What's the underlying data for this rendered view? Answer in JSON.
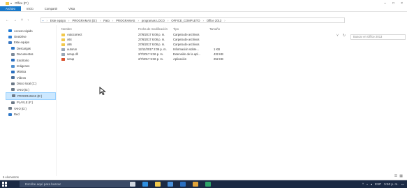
{
  "window": {
    "title": "Office (P:)",
    "ribbon_tabs": [
      "Archivo",
      "Inicio",
      "Compartir",
      "Vista"
    ],
    "caption_buttons": [
      "–",
      "□",
      "×"
    ]
  },
  "address": {
    "crumbs": [
      "Este equipo",
      "PROGRAMAS (D:)",
      "Pato",
      "PROGRAMAS",
      "programas LOCO",
      "OFFICE_COMPLETO",
      "Office 2013"
    ],
    "search_placeholder": "Buscar en Office 2013"
  },
  "nav_pane": {
    "items": [
      {
        "label": "Acceso rápido",
        "icon": "star-icon",
        "color": "#1e7bd6",
        "sub": false
      },
      {
        "label": "OneDrive",
        "icon": "cloud-icon",
        "color": "#2c7fd8",
        "sub": false
      },
      {
        "label": "Este equipo",
        "icon": "computer-icon",
        "color": "#3a78c2",
        "sub": false
      },
      {
        "label": "Descargas",
        "icon": "download-icon",
        "color": "#2f78c8",
        "sub": true
      },
      {
        "label": "Documentos",
        "icon": "document-icon",
        "color": "#7c8a9a",
        "sub": true
      },
      {
        "label": "Escritorio",
        "icon": "desktop-icon",
        "color": "#2a6fc0",
        "sub": true
      },
      {
        "label": "Imágenes",
        "icon": "pictures-icon",
        "color": "#4f8fd0",
        "sub": true
      },
      {
        "label": "Música",
        "icon": "music-icon",
        "color": "#2a6fc0",
        "sub": true
      },
      {
        "label": "Vídeos",
        "icon": "video-icon",
        "color": "#4a6e9a",
        "sub": true
      },
      {
        "label": "Disco local (C:)",
        "icon": "drive-icon",
        "color": "#6d7a88",
        "sub": true
      },
      {
        "label": "VAIO (D:)",
        "icon": "drive-icon",
        "color": "#6d7a88",
        "sub": true
      },
      {
        "label": "PROGRAMAS (E:)",
        "icon": "drive-icon",
        "color": "#6d7a88",
        "sub": true,
        "selected": true
      },
      {
        "label": "PLAYLE (F:)",
        "icon": "drive-icon",
        "color": "#6d7a88",
        "sub": true
      },
      {
        "label": "VAIO (D:)",
        "icon": "drive-icon",
        "color": "#6d7a88",
        "sub": false
      },
      {
        "label": "Red",
        "icon": "network-icon",
        "color": "#2f78c8",
        "sub": false
      }
    ]
  },
  "file_list": {
    "columns": [
      "Nombre",
      "Fecha de modificación",
      "Tipo",
      "Tamaño"
    ],
    "rows": [
      {
        "name": "Autocorrect",
        "date": "27/6/2017 6:08 p. m.",
        "type": "Carpeta de archivos",
        "size": "",
        "kind": "folder"
      },
      {
        "name": "x64",
        "date": "27/6/2017 6:08 p. m.",
        "type": "Carpeta de archivos",
        "size": "",
        "kind": "folder"
      },
      {
        "name": "x86",
        "date": "27/6/2017 6:08 p. m.",
        "type": "Carpeta de archivos",
        "size": "",
        "kind": "folder"
      },
      {
        "name": "autorun",
        "date": "12/12/2017 2:06 p. m.",
        "type": "Información sobre...",
        "size": "1 KB",
        "kind": "file"
      },
      {
        "name": "setup.dll",
        "date": "2/7/2017 5:36 p. m.",
        "type": "Extensión de la apl...",
        "size": "432 KB",
        "kind": "file"
      },
      {
        "name": "setup",
        "date": "2/7/2017 5:36 p. m.",
        "type": "Aplicación",
        "size": "252 KB",
        "kind": "exe"
      }
    ]
  },
  "status": {
    "count": "6 elementos"
  },
  "taskbar": {
    "search_text": "Escribe aquí para buscar",
    "icons": [
      {
        "name": "task-view-icon",
        "color": "#cfd6e0"
      },
      {
        "name": "edge-icon",
        "color": "#2f8fe0"
      },
      {
        "name": "explorer-icon",
        "color": "#f2c94c"
      },
      {
        "name": "store-icon",
        "color": "#4a90d9"
      },
      {
        "name": "mail-icon",
        "color": "#2a6fc0"
      },
      {
        "name": "chrome-icon",
        "color": "#e0a33a"
      },
      {
        "name": "app-icon",
        "color": "#2fa66a"
      }
    ],
    "tray_text": "ESP",
    "time": "5:50 p. m."
  }
}
